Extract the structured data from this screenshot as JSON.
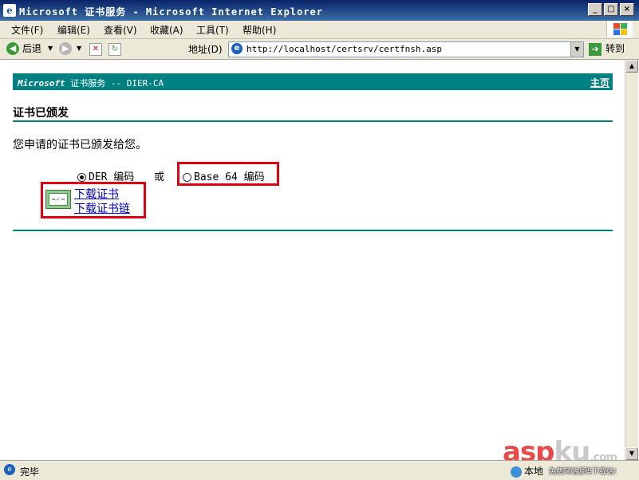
{
  "window": {
    "title": "Microsoft 证书服务 - Microsoft Internet Explorer",
    "controls": [
      "_",
      "□",
      "×"
    ]
  },
  "menu": [
    "文件(F)",
    "编辑(E)",
    "查看(V)",
    "收藏(A)",
    "工具(T)",
    "帮助(H)"
  ],
  "toolbar": {
    "back_label": "后退",
    "address_label": "地址(D)",
    "url": "http://localhost/certsrv/certfnsh.asp",
    "go_label": "转到"
  },
  "page": {
    "brand_prefix": "Microsoft",
    "brand_rest": " 证书服务 --  DIER-CA",
    "home_link": "主页",
    "heading": "证书已颁发",
    "message": "您申请的证书已颁发给您。",
    "encoding_options": [
      {
        "label": "DER 编码",
        "selected": true
      },
      {
        "label": "Base 64 编码",
        "selected": false
      }
    ],
    "or_text": "或",
    "links": [
      "下载证书",
      "下载证书链"
    ]
  },
  "watermark": {
    "asp": "asp",
    "ku": "ku",
    "com": ".com",
    "sub": "免费网站源码下载站!"
  },
  "status": {
    "text": "完毕",
    "zone": "本地"
  },
  "colors": {
    "accent": "#008080",
    "highlight": "#e00010",
    "link": "#0000cc"
  }
}
